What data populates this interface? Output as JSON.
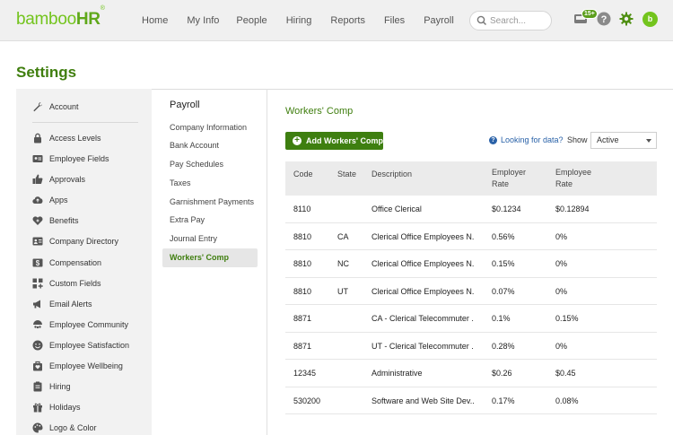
{
  "brand": {
    "logo_text_part1": "bamboo",
    "logo_text_part2": "HR",
    "logo_mark": "®",
    "color": "#73c41d"
  },
  "nav": {
    "items": [
      "Home",
      "My Info",
      "People",
      "Hiring",
      "Reports",
      "Files",
      "Payroll"
    ]
  },
  "search": {
    "placeholder": "Search..."
  },
  "toolbar": {
    "inbox_badge": "15+",
    "avatar_text": "b"
  },
  "page": {
    "title": "Settings"
  },
  "sidebar": {
    "account": "Account",
    "items": [
      {
        "label": "Access Levels",
        "icon": "lock-icon"
      },
      {
        "label": "Employee Fields",
        "icon": "id-card-icon"
      },
      {
        "label": "Approvals",
        "icon": "thumbs-up-icon"
      },
      {
        "label": "Apps",
        "icon": "cloud-icon"
      },
      {
        "label": "Benefits",
        "icon": "heart-icon"
      },
      {
        "label": "Company Directory",
        "icon": "contact-card-icon"
      },
      {
        "label": "Compensation",
        "icon": "dollar-icon"
      },
      {
        "label": "Custom Fields",
        "icon": "grid-plus-icon"
      },
      {
        "label": "Email Alerts",
        "icon": "megaphone-icon"
      },
      {
        "label": "Employee Community",
        "icon": "community-icon"
      },
      {
        "label": "Employee Satisfaction",
        "icon": "smiley-icon"
      },
      {
        "label": "Employee Wellbeing",
        "icon": "wellbeing-icon"
      },
      {
        "label": "Hiring",
        "icon": "clipboard-icon"
      },
      {
        "label": "Holidays",
        "icon": "gift-icon"
      },
      {
        "label": "Logo & Color",
        "icon": "palette-icon"
      }
    ]
  },
  "subnav": {
    "title": "Payroll",
    "items": [
      "Company Information",
      "Bank Account",
      "Pay Schedules",
      "Taxes",
      "Garnishment Payments",
      "Extra Pay",
      "Journal Entry",
      "Workers' Comp"
    ],
    "active_index": 7
  },
  "main": {
    "title": "Workers' Comp",
    "add_button": "Add Workers' Comp",
    "looking_link": "Looking for data?",
    "show_label": "Show",
    "show_value": "Active",
    "columns": {
      "code": "Code",
      "state": "State",
      "description": "Description",
      "employer_rate_1": "Employer",
      "employer_rate_2": "Rate",
      "employee_rate_1": "Employee",
      "employee_rate_2": "Rate"
    },
    "rows": [
      {
        "code": "8110",
        "state": "",
        "description": "Office Clerical",
        "employer": "$0.1234",
        "employee": "$0.12894"
      },
      {
        "code": "8810",
        "state": "CA",
        "description": "Clerical Office Employees N...",
        "employer": "0.56%",
        "employee": "0%"
      },
      {
        "code": "8810",
        "state": "NC",
        "description": "Clerical Office Employees N...",
        "employer": "0.15%",
        "employee": "0%"
      },
      {
        "code": "8810",
        "state": "UT",
        "description": "Clerical Office Employees N...",
        "employer": "0.07%",
        "employee": "0%"
      },
      {
        "code": "8871",
        "state": "",
        "description": "CA - Clerical Telecommuter ...",
        "employer": "0.1%",
        "employee": "0.15%"
      },
      {
        "code": "8871",
        "state": "",
        "description": "UT - Clerical Telecommuter ...",
        "employer": "0.28%",
        "employee": "0%"
      },
      {
        "code": "12345",
        "state": "",
        "description": "Administrative",
        "employer": "$0.26",
        "employee": "$0.45"
      },
      {
        "code": "530200",
        "state": "",
        "description": "Software and Web Site Dev...",
        "employer": "0.17%",
        "employee": "0.08%"
      }
    ]
  },
  "colors": {
    "accent": "#3f7e0e",
    "link": "#2a62a8",
    "brand_green": "#73c41d"
  }
}
